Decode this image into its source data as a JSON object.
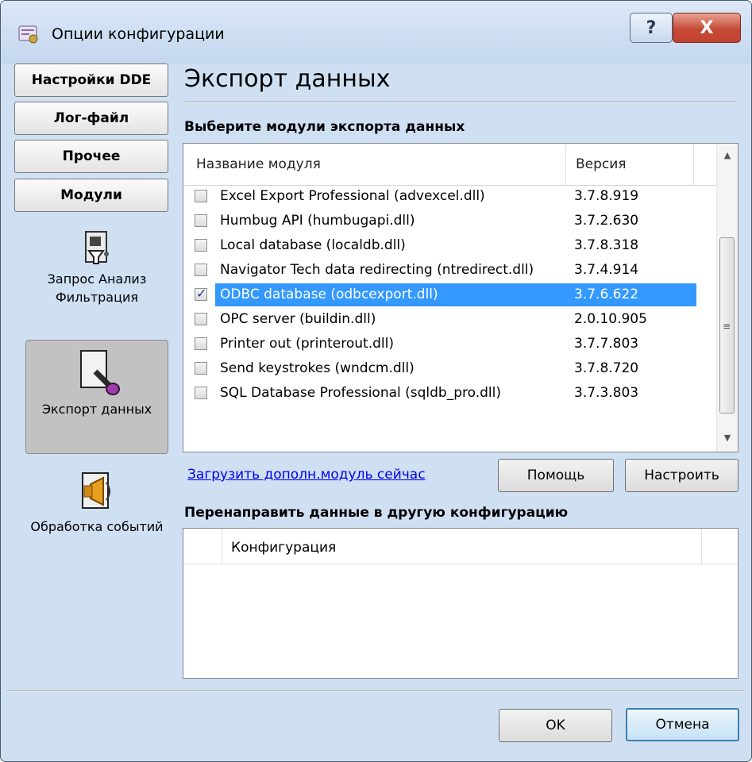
{
  "window": {
    "title": "Опции конфигурации"
  },
  "titlebar_buttons": {
    "help": "?",
    "close": "X"
  },
  "nav": {
    "buttons": [
      {
        "label": "Настройки DDE"
      },
      {
        "label": "Лог-файл"
      },
      {
        "label": "Прочее"
      },
      {
        "label": "Модули"
      }
    ],
    "items": [
      {
        "label": "Запрос Анализ Фильтрация"
      },
      {
        "label": "Экспорт данных",
        "selected": true
      },
      {
        "label": "Обработка событий"
      }
    ]
  },
  "main": {
    "heading": "Экспорт данных",
    "modules_label": "Выберите модули экспорта данных",
    "columns": {
      "name": "Название модуля",
      "version": "Версия"
    },
    "modules": [
      {
        "name": "Excel Export Professional (advexcel.dll)",
        "version": "3.7.8.919",
        "checked": false
      },
      {
        "name": "Humbug API (humbugapi.dll)",
        "version": "3.7.2.630",
        "checked": false
      },
      {
        "name": "Local database (localdb.dll)",
        "version": "3.7.8.318",
        "checked": false
      },
      {
        "name": "Navigator Tech data redirecting (ntredirect.dll)",
        "version": "3.7.4.914",
        "checked": false
      },
      {
        "name": "ODBC database (odbcexport.dll)",
        "version": "3.7.6.622",
        "checked": true,
        "selected": true
      },
      {
        "name": "OPC server (buildin.dll)",
        "version": "2.0.10.905",
        "checked": false
      },
      {
        "name": "Printer out (printerout.dll)",
        "version": "3.7.7.803",
        "checked": false
      },
      {
        "name": "Send keystrokes (wndcm.dll)",
        "version": "3.7.8.720",
        "checked": false
      },
      {
        "name": "SQL Database Professional (sqldb_pro.dll)",
        "version": "3.7.3.803",
        "checked": false
      }
    ],
    "download_link": "Загрузить дополн.модуль сейчас",
    "help_button": "Помощь",
    "configure_button": "Настроить",
    "redirect_label": "Перенаправить данные в другую конфигурацию",
    "config_column": "Конфигурация"
  },
  "footer": {
    "ok": "OK",
    "cancel": "Отмена"
  },
  "colors": {
    "selection": "#3399ff",
    "title_bg": "#c4d7ef",
    "close_red": "#c54b37",
    "link": "#0000ee"
  }
}
